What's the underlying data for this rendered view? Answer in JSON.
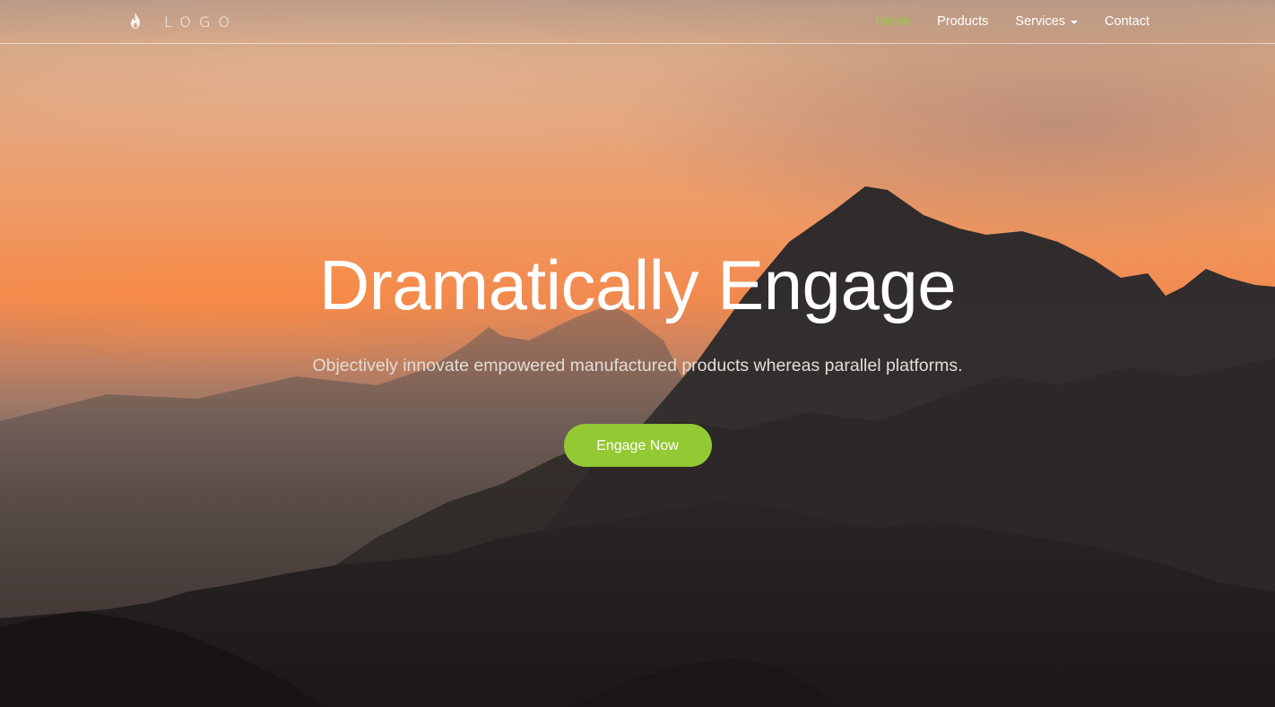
{
  "brand": {
    "logo_icon": "flame-icon",
    "logo_text": "LOGO"
  },
  "nav": {
    "items": [
      {
        "label": "Home",
        "active": true
      },
      {
        "label": "Products",
        "active": false
      },
      {
        "label": "Services",
        "active": false,
        "has_dropdown": true
      },
      {
        "label": "Contact",
        "active": false
      }
    ]
  },
  "hero": {
    "title": "Dramatically Engage",
    "subtitle": "Objectively innovate empowered manufactured products whereas parallel platforms.",
    "cta_label": "Engage Now",
    "background": "mountain-sunset-photo"
  },
  "colors": {
    "accent": "#93c932",
    "active_nav": "#8fd13a",
    "text": "#ffffff"
  }
}
